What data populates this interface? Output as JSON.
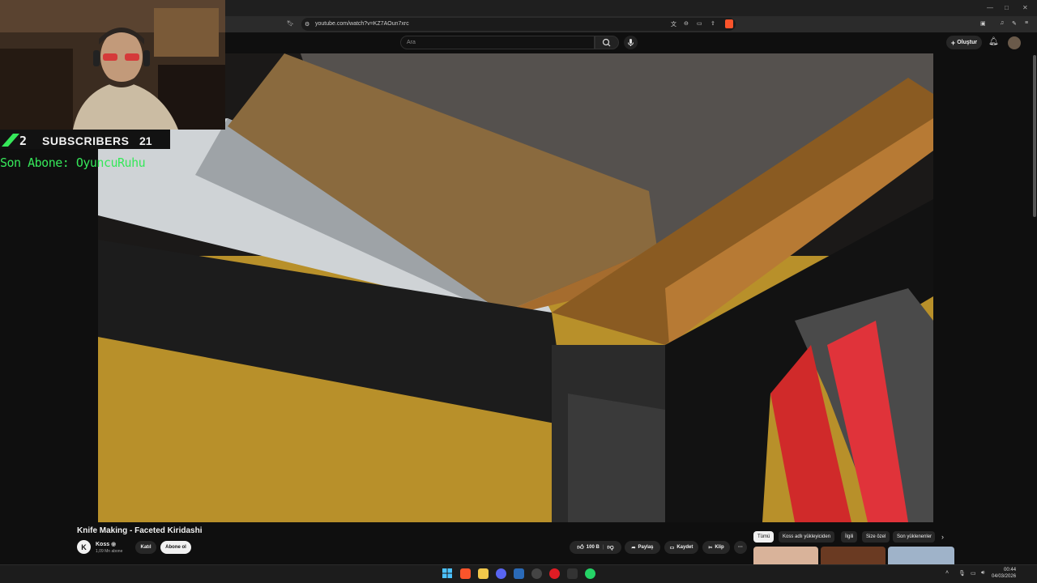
{
  "browser": {
    "url": "youtube.com/watch?v=KZ7AOun7xrc"
  },
  "header": {
    "search_placeholder": "Ara",
    "create_label": "Oluştur"
  },
  "overlay": {
    "sub_count": "2",
    "sub_label": "SUBSCRIBERS",
    "sub_number": "21",
    "last_sub": "Son Abone: OyuncuRuhu"
  },
  "video": {
    "title": "Knife Making - Faceted Kiridashi",
    "channel_initial": "K",
    "channel_name": "Koss",
    "channel_subs": "1,09 Mn abone",
    "join_label": "Katıl",
    "subscribe_label": "Abone ol",
    "like_count": "100 B",
    "share_label": "Paylaş",
    "save_label": "Kaydet",
    "clip_label": "Klip",
    "more_label": "···"
  },
  "chips": [
    "Tümü",
    "Koss adlı yükleyiciden",
    "İlgili",
    "Size özel",
    "Son yüklenenler"
  ],
  "taskbar": {
    "time": "00:44",
    "date": "04/03/2026"
  },
  "colors": {
    "accent_green": "#36e85a",
    "background": "#0f0f0f"
  }
}
